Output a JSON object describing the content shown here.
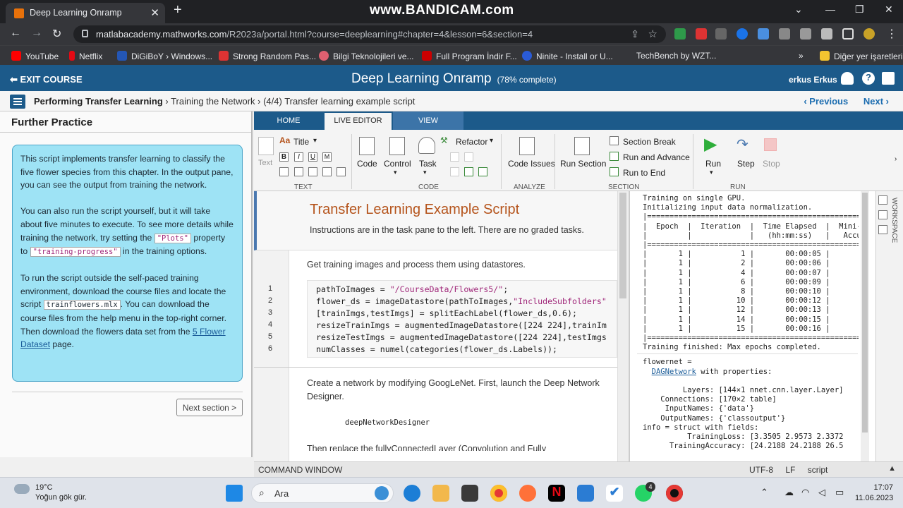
{
  "browser": {
    "tab_title": "Deep Learning Onramp",
    "tab_close": "✕",
    "new_tab": "+",
    "recorder_watermark": "www.BANDICAM.com",
    "url_host": "matlabacademy.mathworks.com",
    "url_path": "/R2023a/portal.html?course=deeplearning#chapter=4&lesson=6&section=4",
    "bookmarks": [
      "YouTube",
      "Netflix",
      "DiGiBoY › Windows...",
      "Strong Random Pas...",
      "Bilgi Teknolojileri ve...",
      "Full Program İndir F...",
      "Ninite - Install or U...",
      "TechBench by WZT...",
      "»",
      "Diğer yer işaretleri"
    ]
  },
  "course": {
    "exit_label": "EXIT COURSE",
    "title": "Deep Learning Onramp",
    "progress": "(78% complete)",
    "user": "erkus Erkus",
    "breadcrumb_bold": "Performing Transfer Learning",
    "breadcrumb_rest": " › Training the Network › (4/4) Transfer learning example script",
    "previous": "‹ Previous",
    "next": "Next ›"
  },
  "task_pane": {
    "header": "Further Practice",
    "p1": "This script implements transfer learning to classify the five flower species from this chapter. In the output pane, you can see the output from training the network.",
    "p2_a": "You can also run the script yourself, but it will take about five minutes to execute. To see more details while training the network, try setting the ",
    "p2_code1": "\"Plots\"",
    "p2_b": " property to ",
    "p2_code2": "\"training-progress\"",
    "p2_c": " in the training options.",
    "p3_a": "To run the script outside the self-paced training environment, download the course files and locate the script ",
    "p3_code": "trainflowers.mlx",
    "p3_b": ". You can download the course files from the help menu in the top-right corner. Then download the flowers data set from the ",
    "p3_link": "5 Flower Dataset",
    "p3_c": " page.",
    "next_section": "Next section >"
  },
  "editor": {
    "tabs": [
      "HOME",
      "LIVE EDITOR",
      "VIEW"
    ],
    "active_tab": "LIVE EDITOR",
    "toolstrip": {
      "text_group": "TEXT",
      "code_group": "CODE",
      "analyze_group": "ANALYZE",
      "section_group": "SECTION",
      "run_group": "RUN",
      "text_btn": "Text",
      "title_btn": "Title",
      "code_btn": "Code",
      "control_btn": "Control",
      "task_btn": "Task",
      "refactor_btn": "Refactor",
      "code_issues_btn": "Code Issues",
      "run_section_btn": "Run Section",
      "section_break_btn": "Section Break",
      "run_advance_btn": "Run and Advance",
      "run_end_btn": "Run to End",
      "run_btn": "Run",
      "step_btn": "Step",
      "stop_btn": "Stop"
    },
    "doc_title": "Transfer Learning Example Script",
    "doc_subtitle": "Instructions are in the task pane to the left. There are no graded tasks.",
    "section2_text": "Get training images and process them using datastores.",
    "code_lines": [
      {
        "n": "1",
        "a": "pathToImages = ",
        "s": "\"/CourseData/Flowers5/\"",
        "b": ";"
      },
      {
        "n": "2",
        "a": "flower_ds = imageDatastore(pathToImages,",
        "s": "\"IncludeSubfolders\"",
        "b": ""
      },
      {
        "n": "3",
        "a": "[trainImgs,testImgs] = splitEachLabel(flower_ds,0.6);",
        "s": "",
        "b": ""
      },
      {
        "n": "4",
        "a": "resizeTrainImgs = augmentedImageDatastore([224 224],trainIm",
        "s": "",
        "b": ""
      },
      {
        "n": "5",
        "a": "resizeTestImgs = augmentedImageDatastore([224 224],testImgs",
        "s": "",
        "b": ""
      },
      {
        "n": "6",
        "a": "numClasses = numel(categories(flower_ds.Labels));",
        "s": "",
        "b": ""
      }
    ],
    "section3_text": "Create a network by modifying GoogLeNet. First, launch the Deep Network Designer.",
    "section3_code": "deepNetworkDesigner",
    "section3_cut": "Then replace the fullyConnectedLayer (Convolution and Fully"
  },
  "output": {
    "lines_top": [
      "Training on single GPU.",
      "Initializing input data normalization.",
      "|========================================================",
      "|  Epoch  |  Iteration  |  Time Elapsed  |  Mini-",
      "|         |             |   (hh:mm:ss)   |   Accu",
      "|========================================================",
      "|       1 |           1 |       00:00:05 |",
      "|       1 |           2 |       00:00:06 |",
      "|       1 |           4 |       00:00:07 |",
      "|       1 |           6 |       00:00:09 |",
      "|       1 |           8 |       00:00:10 |",
      "|       1 |          10 |       00:00:12 |",
      "|       1 |          12 |       00:00:13 |",
      "|       1 |          14 |       00:00:15 |",
      "|       1 |          15 |       00:00:16 |",
      "|========================================================",
      "Training finished: Max epochs completed."
    ],
    "flowernet": "flowernet = ",
    "dagnetwork": "DAGNetwork",
    "with_props": " with properties:",
    "props": [
      "         Layers: [144×1 nnet.cnn.layer.Layer]",
      "    Connections: [170×2 table]",
      "     InputNames: {'data'}",
      "    OutputNames: {'classoutput'}"
    ],
    "info": "info = struct with fields:",
    "info_lines": [
      "          TrainingLoss: [3.3505 2.9573 2.3372",
      "      TrainingAccuracy: [24.2188 24.2188 26.5"
    ],
    "workspace": "WORKSPACE"
  },
  "status": {
    "command_window": "COMMAND WINDOW",
    "encoding": "UTF-8",
    "eol": "LF",
    "mode": "script"
  },
  "taskbar": {
    "temp": "19°C",
    "weather": "Yoğun gök gür.",
    "search": "Ara",
    "badge": "4",
    "time": "17:07",
    "date": "11.06.2023"
  },
  "colors": {
    "header": "#1c5a8a",
    "task_pane": "#9ee3f5",
    "string": "#a0287a",
    "title": "#b5541c"
  }
}
